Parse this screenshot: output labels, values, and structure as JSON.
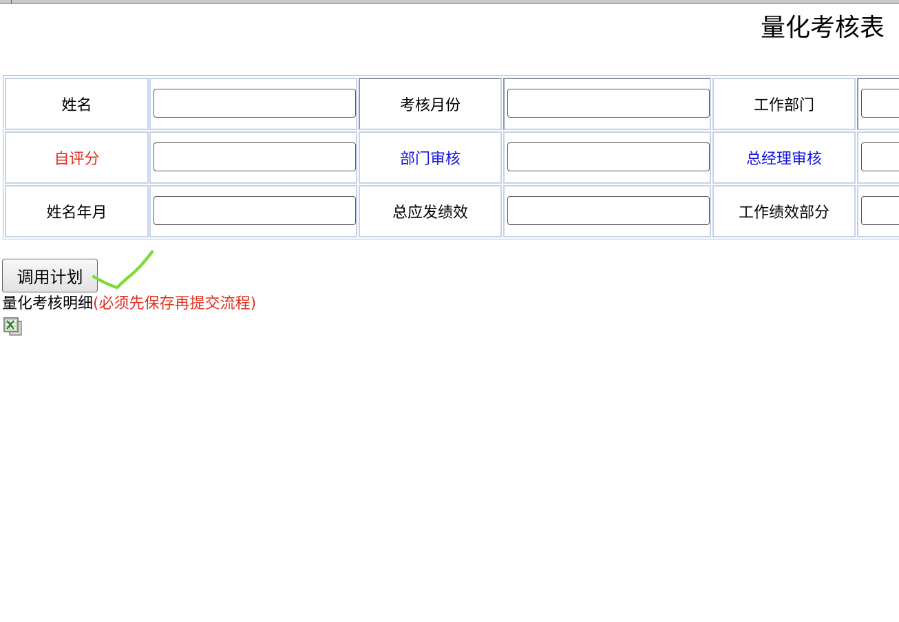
{
  "page": {
    "title": "量化考核表"
  },
  "form": {
    "rows": [
      [
        {
          "label": "姓名",
          "color": "#000000"
        },
        {
          "label": "考核月份",
          "color": "#000000"
        },
        {
          "label": "工作部门",
          "color": "#000000"
        }
      ],
      [
        {
          "label": "自评分",
          "color": "#e03020"
        },
        {
          "label": "部门审核",
          "color": "#1515e0"
        },
        {
          "label": "总经理审核",
          "color": "#1515e0"
        }
      ],
      [
        {
          "label": "姓名年月",
          "color": "#000000"
        },
        {
          "label": "总应发绩效",
          "color": "#000000"
        },
        {
          "label": "工作绩效部分",
          "color": "#000000"
        }
      ]
    ],
    "values": [
      "",
      "",
      "",
      "",
      "",
      "",
      "",
      "",
      ""
    ]
  },
  "actions": {
    "call_plan_label": "调用计划"
  },
  "detail": {
    "title": "量化考核明细",
    "note": "(必须先保存再提交流程)"
  },
  "icons": {
    "export": "excel-export-icon",
    "annotation": "green-checkmark-annotation"
  },
  "colors": {
    "border": "#c3d2ea",
    "red": "#e03020",
    "blue": "#1515e0",
    "annotation_green": "#7ddc3a"
  }
}
